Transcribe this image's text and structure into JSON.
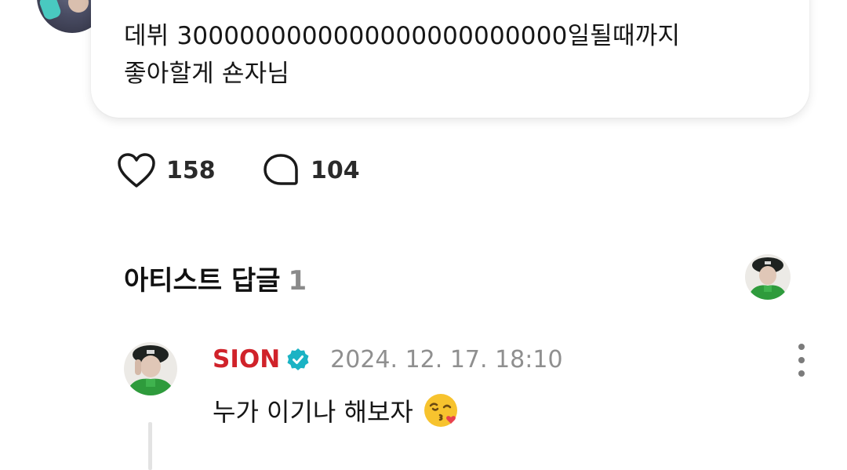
{
  "post": {
    "text": "데뷔 3000000000000000000000000일될때까지\n좋아할게 숀자님",
    "likes": "158",
    "comments": "104"
  },
  "artist_replies": {
    "title": "아티스트 답글",
    "count": "1"
  },
  "reply": {
    "author": "SION",
    "date": "2024. 12. 17. 18:10",
    "text": "누가 이기나 해보자",
    "emoji": "face-blowing-a-kiss"
  },
  "colors": {
    "author_red": "#d0222a",
    "verified_teal": "#1ab3c4",
    "muted_gray": "#8f8f8f"
  },
  "icons": [
    "heart-icon",
    "comment-bubble-icon",
    "verified-badge-icon",
    "more-vertical-icon"
  ]
}
